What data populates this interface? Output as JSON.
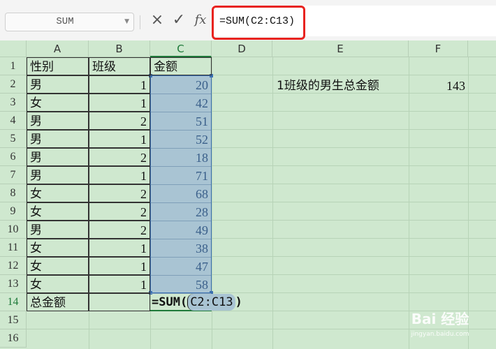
{
  "toolbar": {
    "name_box": "SUM",
    "cancel_icon": "×",
    "enter_icon": "✓",
    "fx_label": "fx",
    "formula": "=SUM(C2:C13)"
  },
  "columns": [
    "A",
    "B",
    "C",
    "D",
    "E",
    "F"
  ],
  "rows": [
    "1",
    "2",
    "3",
    "4",
    "5",
    "6",
    "7",
    "8",
    "9",
    "10",
    "11",
    "12",
    "13",
    "14",
    "15",
    "16"
  ],
  "headers": {
    "gender": "性别",
    "class": "班级",
    "amount": "金额"
  },
  "data": [
    {
      "gender": "男",
      "class": "1",
      "amount": "20"
    },
    {
      "gender": "女",
      "class": "1",
      "amount": "42"
    },
    {
      "gender": "男",
      "class": "2",
      "amount": "51"
    },
    {
      "gender": "男",
      "class": "1",
      "amount": "52"
    },
    {
      "gender": "男",
      "class": "2",
      "amount": "18"
    },
    {
      "gender": "男",
      "class": "1",
      "amount": "71"
    },
    {
      "gender": "女",
      "class": "2",
      "amount": "68"
    },
    {
      "gender": "女",
      "class": "2",
      "amount": "28"
    },
    {
      "gender": "男",
      "class": "2",
      "amount": "49"
    },
    {
      "gender": "女",
      "class": "1",
      "amount": "38"
    },
    {
      "gender": "女",
      "class": "1",
      "amount": "47"
    },
    {
      "gender": "女",
      "class": "1",
      "amount": "58"
    }
  ],
  "total_row": {
    "label": "总金额",
    "formula_prefix": "=SUM(",
    "formula_ref": "C2:C13",
    "formula_suffix": ")"
  },
  "summary": {
    "label": "1班级的男生总金额",
    "value": "143"
  },
  "watermark": {
    "title": "Bai 经验",
    "url": "jingyan.baidu.com"
  },
  "colors": {
    "grid_bg": "#cfe8cf",
    "selection": "#a9c4d3",
    "highlight": "#e8231f",
    "active": "#1f7a3a"
  }
}
